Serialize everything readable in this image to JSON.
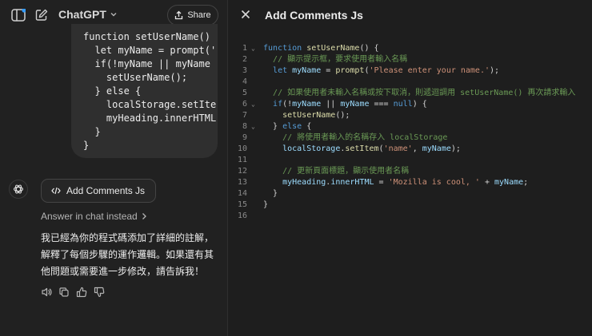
{
  "header": {
    "model_label": "ChatGPT",
    "share_label": "Share"
  },
  "chat": {
    "code_snippet_lines": [
      "function setUserName()",
      "  let myName = prompt('",
      "  if(!myName || myName",
      "    setUserName();",
      "  } else {",
      "    localStorage.setIte",
      "    myHeading.innerHTML",
      "  }",
      "}"
    ],
    "canvas_chip_label": "Add Comments Js",
    "answer_in_chat_label": "Answer in chat instead",
    "reply_text": "我已經為你的程式碼添加了詳細的註解，解釋了每個步驟的運作邏輯。如果還有其他問題或需要進一步修改，請告訴我！"
  },
  "canvas": {
    "title": "Add Comments Js",
    "lines": [
      {
        "n": "1",
        "fold": true
      },
      {
        "n": "2",
        "fold": false
      },
      {
        "n": "3",
        "fold": false
      },
      {
        "n": "4",
        "fold": false
      },
      {
        "n": "5",
        "fold": false
      },
      {
        "n": "6",
        "fold": true
      },
      {
        "n": "7",
        "fold": false
      },
      {
        "n": "8",
        "fold": true
      },
      {
        "n": "9",
        "fold": false
      },
      {
        "n": "10",
        "fold": false
      },
      {
        "n": "11",
        "fold": false
      },
      {
        "n": "12",
        "fold": false
      },
      {
        "n": "13",
        "fold": false
      },
      {
        "n": "14",
        "fold": false
      },
      {
        "n": "15",
        "fold": false
      },
      {
        "n": "16",
        "fold": false
      }
    ],
    "code": {
      "l1_kw": "function",
      "l1_fn": "setUserName",
      "l1_rest": "() {",
      "l2_cm": "// 顯示提示框，要求使用者輸入名稱",
      "l3_kw": "let",
      "l3_var": "myName",
      "l3_eq": " = ",
      "l3_fn": "prompt",
      "l3_str": "'Please enter your name.'",
      "l3_end": ");",
      "l5_cm": "// 如果使用者未輸入名稱或按下取消，則遞迴調用 setUserName() 再次請求輸入",
      "l6_kw": "if",
      "l6_a": "(!",
      "l6_var1": "myName",
      "l6_b": " || ",
      "l6_var2": "myName",
      "l6_c": " === ",
      "l6_null": "null",
      "l6_d": ") {",
      "l7_fn": "setUserName",
      "l7_end": "();",
      "l8_a": "} ",
      "l8_kw": "else",
      "l8_b": " {",
      "l9_cm": "// 將使用者輸入的名稱存入 localStorage",
      "l10_var": "localStorage",
      "l10_dot": ".",
      "l10_fn": "setItem",
      "l10_p": "(",
      "l10_str": "'name'",
      "l10_comma": ", ",
      "l10_var2": "myName",
      "l10_end": ");",
      "l12_cm": "// 更新頁面標題，顯示使用者名稱",
      "l13_var": "myHeading",
      "l13_dot": ".",
      "l13_prop": "innerHTML",
      "l13_eq": " = ",
      "l13_str": "'Mozilla is cool, '",
      "l13_plus": " + ",
      "l13_var2": "myName",
      "l13_end": ";",
      "l14": "}",
      "l15": "}"
    }
  },
  "icons": {
    "sidebar": "sidebar-toggle-icon",
    "compose": "new-chat-icon",
    "chevron": "chevron-down-icon",
    "share": "share-icon",
    "gpt": "openai-logo-icon",
    "code": "code-icon",
    "close": "close-icon"
  }
}
